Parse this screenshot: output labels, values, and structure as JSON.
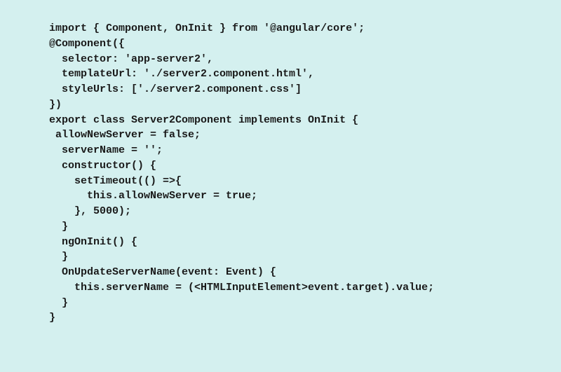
{
  "code": {
    "lines": [
      "import { Component, OnInit } from '@angular/core';",
      "",
      "@Component({",
      "  selector: 'app-server2',",
      "  templateUrl: './server2.component.html',",
      "  styleUrls: ['./server2.component.css']",
      "})",
      "export class Server2Component implements OnInit {",
      " allowNewServer = false;",
      "  serverName = '';",
      "  constructor() {",
      "    setTimeout(() =>{",
      "      this.allowNewServer = true;",
      "    }, 5000);",
      "  }",
      "",
      "  ngOnInit() {",
      "  }",
      "  OnUpdateServerName(event: Event) {",
      "    this.serverName = (<HTMLInputElement>event.target).value;",
      "  }",
      "}"
    ]
  }
}
